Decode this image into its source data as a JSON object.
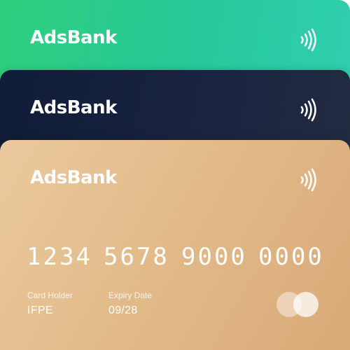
{
  "cards": [
    {
      "brand": "AdsBank",
      "color": "#2ccf8a"
    },
    {
      "brand": "AdsBank",
      "color": "#131e38"
    },
    {
      "brand": "AdsBank",
      "color": "#e2bb8a",
      "number_groups": [
        "1234",
        "5678",
        "9000",
        "0000"
      ],
      "holder_label": "Card Holder",
      "holder_value": "IFPE",
      "expiry_label": "Expiry Date",
      "expiry_value": "09/28"
    }
  ],
  "icons": {
    "contactless": "contactless-icon",
    "card_network": "mastercard-logo"
  }
}
